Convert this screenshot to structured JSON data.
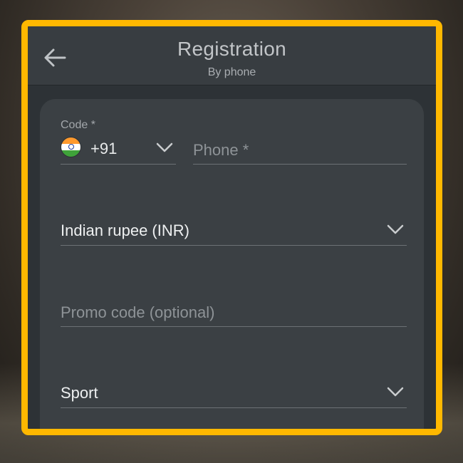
{
  "header": {
    "title": "Registration",
    "subtitle": "By phone"
  },
  "form": {
    "code_label": "Code *",
    "country_code": "+91",
    "flag": "india-flag",
    "phone_placeholder": "Phone *",
    "currency_value": "Indian rupee (INR)",
    "promo_placeholder": "Promo code (optional)",
    "bonus_value": "Sport"
  },
  "icons": {
    "back": "arrow-left-icon",
    "dropdown": "chevron-down-icon"
  },
  "colors": {
    "frame_border": "#ffb800",
    "panel_bg": "#3b4044",
    "header_bg": "#383d41"
  }
}
